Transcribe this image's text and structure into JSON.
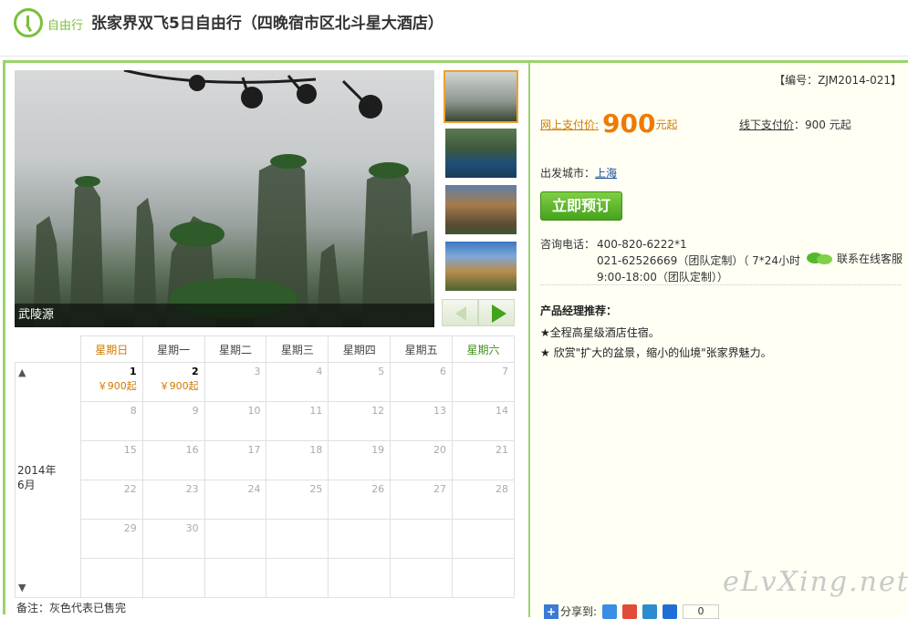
{
  "header": {
    "tag": "自由行",
    "title": "张家界双飞5日自由行（四晚宿市区北斗星大酒店）"
  },
  "hero": {
    "caption": "武陵源"
  },
  "thumbs": [
    {
      "name": "thumb-1"
    },
    {
      "name": "thumb-2"
    },
    {
      "name": "thumb-3"
    },
    {
      "name": "thumb-4"
    }
  ],
  "calendar": {
    "weekdays": [
      "星期日",
      "星期一",
      "星期二",
      "星期三",
      "星期四",
      "星期五",
      "星期六"
    ],
    "year_label": "2014年",
    "month_label": "6月",
    "up_arrow": "▲",
    "down_arrow": "▼",
    "weeks": [
      [
        {
          "d": "1",
          "p": "￥900起"
        },
        {
          "d": "2",
          "p": "￥900起"
        },
        {
          "d": "3"
        },
        {
          "d": "4"
        },
        {
          "d": "5"
        },
        {
          "d": "6"
        },
        {
          "d": "7"
        }
      ],
      [
        {
          "d": "8"
        },
        {
          "d": "9"
        },
        {
          "d": "10"
        },
        {
          "d": "11"
        },
        {
          "d": "12"
        },
        {
          "d": "13"
        },
        {
          "d": "14"
        }
      ],
      [
        {
          "d": "15"
        },
        {
          "d": "16"
        },
        {
          "d": "17"
        },
        {
          "d": "18"
        },
        {
          "d": "19"
        },
        {
          "d": "20"
        },
        {
          "d": "21"
        }
      ],
      [
        {
          "d": "22"
        },
        {
          "d": "23"
        },
        {
          "d": "24"
        },
        {
          "d": "25"
        },
        {
          "d": "26"
        },
        {
          "d": "27"
        },
        {
          "d": "28"
        }
      ],
      [
        {
          "d": "29"
        },
        {
          "d": "30"
        },
        {
          "d": ""
        },
        {
          "d": ""
        },
        {
          "d": ""
        },
        {
          "d": ""
        },
        {
          "d": ""
        }
      ],
      [
        {
          "d": ""
        },
        {
          "d": ""
        },
        {
          "d": ""
        },
        {
          "d": ""
        },
        {
          "d": ""
        },
        {
          "d": ""
        },
        {
          "d": ""
        }
      ]
    ],
    "note": "备注：灰色代表已售完"
  },
  "info": {
    "code": "【编号：ZJM2014-021】",
    "online_label": "网上支付价:",
    "online_price": "900",
    "online_suffix": "元起",
    "offline_label": "线下支付价",
    "offline_value": "：900 元起",
    "depart_label": "出发城市：",
    "depart_city": "上海",
    "book_label": "立即预订",
    "phone_label": "咨询电话：",
    "phone_lines": [
      "400-820-6222*1",
      "021-62526669（团队定制）（ 7*24小时",
      "9:00-18:00（团队定制））"
    ],
    "chat_label": "联系在线客服",
    "rec_title": "产品经理推荐：",
    "rec_items": [
      "★全程高星级酒店住宿。",
      "★ 欣赏\"扩大的盆景，缩小的仙境\"张家界魅力。"
    ],
    "share_label": "分享到:",
    "share_count": "0",
    "watermark": "eLvXing.net"
  },
  "colors": {
    "accent": "#9ad46a",
    "price": "#f07a00",
    "button": "#46a31c"
  }
}
